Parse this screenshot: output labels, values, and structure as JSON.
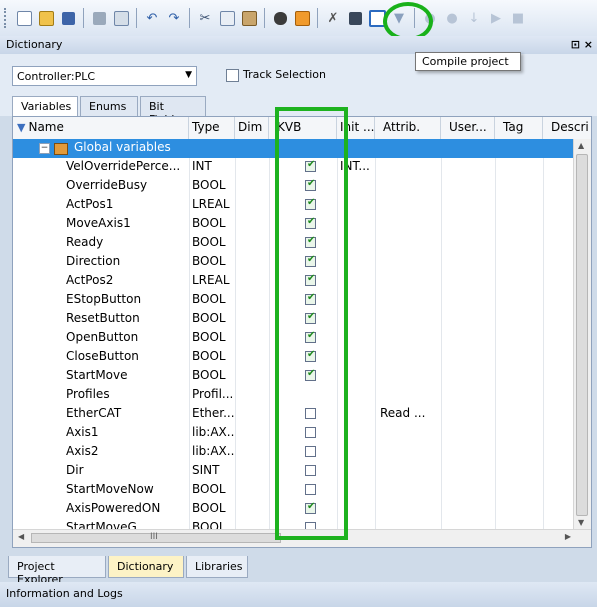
{
  "toolbar": {
    "icons": [
      "new-icon",
      "open-icon",
      "save-icon",
      "save-all-icon",
      "print-icon",
      "print-preview-icon",
      "undo-icon",
      "redo-icon",
      "cut-icon",
      "copy-icon",
      "paste-icon",
      "find-icon",
      "toggle-icon",
      "build-icon",
      "compile-list-icon",
      "compile-project-icon",
      "compile-next-icon",
      "debug-icon",
      "debug2-icon",
      "step-icon",
      "run-icon",
      "stop-icon"
    ],
    "tooltip": "Compile project"
  },
  "panel": {
    "title": "Dictionary",
    "controls": "` ×"
  },
  "controller": {
    "selected": "Controller:PLC",
    "track_selection_label": "Track Selection"
  },
  "tabs": [
    "Variables",
    "Enums",
    "Bit Fields"
  ],
  "columns": [
    "Name",
    "Type",
    "Dim",
    "KVB",
    "Init ...",
    "Attrib.",
    "User...",
    "Tag",
    "Descri"
  ],
  "group": {
    "label": "Global variables"
  },
  "rows": [
    {
      "name": "VelOverridePerce...",
      "type": "INT",
      "kvb": true,
      "init": "INT...",
      "attrib": ""
    },
    {
      "name": "OverrideBusy",
      "type": "BOOL",
      "kvb": true,
      "init": "",
      "attrib": ""
    },
    {
      "name": "ActPos1",
      "type": "LREAL",
      "kvb": true,
      "init": "",
      "attrib": ""
    },
    {
      "name": "MoveAxis1",
      "type": "BOOL",
      "kvb": true,
      "init": "",
      "attrib": ""
    },
    {
      "name": "Ready",
      "type": "BOOL",
      "kvb": true,
      "init": "",
      "attrib": ""
    },
    {
      "name": "Direction",
      "type": "BOOL",
      "kvb": true,
      "init": "",
      "attrib": ""
    },
    {
      "name": "ActPos2",
      "type": "LREAL",
      "kvb": true,
      "init": "",
      "attrib": ""
    },
    {
      "name": "EStopButton",
      "type": "BOOL",
      "kvb": true,
      "init": "",
      "attrib": ""
    },
    {
      "name": "ResetButton",
      "type": "BOOL",
      "kvb": true,
      "init": "",
      "attrib": ""
    },
    {
      "name": "OpenButton",
      "type": "BOOL",
      "kvb": true,
      "init": "",
      "attrib": ""
    },
    {
      "name": "CloseButton",
      "type": "BOOL",
      "kvb": true,
      "init": "",
      "attrib": ""
    },
    {
      "name": "StartMove",
      "type": "BOOL",
      "kvb": true,
      "init": "",
      "attrib": ""
    },
    {
      "name": "Profiles",
      "type": "Profil...",
      "kvb": null,
      "init": "",
      "attrib": ""
    },
    {
      "name": "EtherCAT",
      "type": "Ether...",
      "kvb": false,
      "init": "",
      "attrib": "Read ..."
    },
    {
      "name": "Axis1",
      "type": "lib:AX...",
      "kvb": false,
      "init": "",
      "attrib": ""
    },
    {
      "name": "Axis2",
      "type": "lib:AX...",
      "kvb": false,
      "init": "",
      "attrib": ""
    },
    {
      "name": "Dir",
      "type": "SINT",
      "kvb": false,
      "init": "",
      "attrib": ""
    },
    {
      "name": "StartMoveNow",
      "type": "BOOL",
      "kvb": false,
      "init": "",
      "attrib": ""
    },
    {
      "name": "AxisPoweredON",
      "type": "BOOL",
      "kvb": true,
      "init": "",
      "attrib": ""
    },
    {
      "name": "StartMoveG",
      "type": "BOOL",
      "kvb": false,
      "init": "",
      "attrib": ""
    }
  ],
  "hscroll_marker": "III",
  "bottom_tabs": [
    "Project Explorer",
    "Dictionary",
    "Libraries"
  ],
  "info_bar": "Information and Logs",
  "colors": {
    "selection": "#2d8ee0",
    "highlight": "#1db21f",
    "active_tab": "#fdf3c6"
  }
}
